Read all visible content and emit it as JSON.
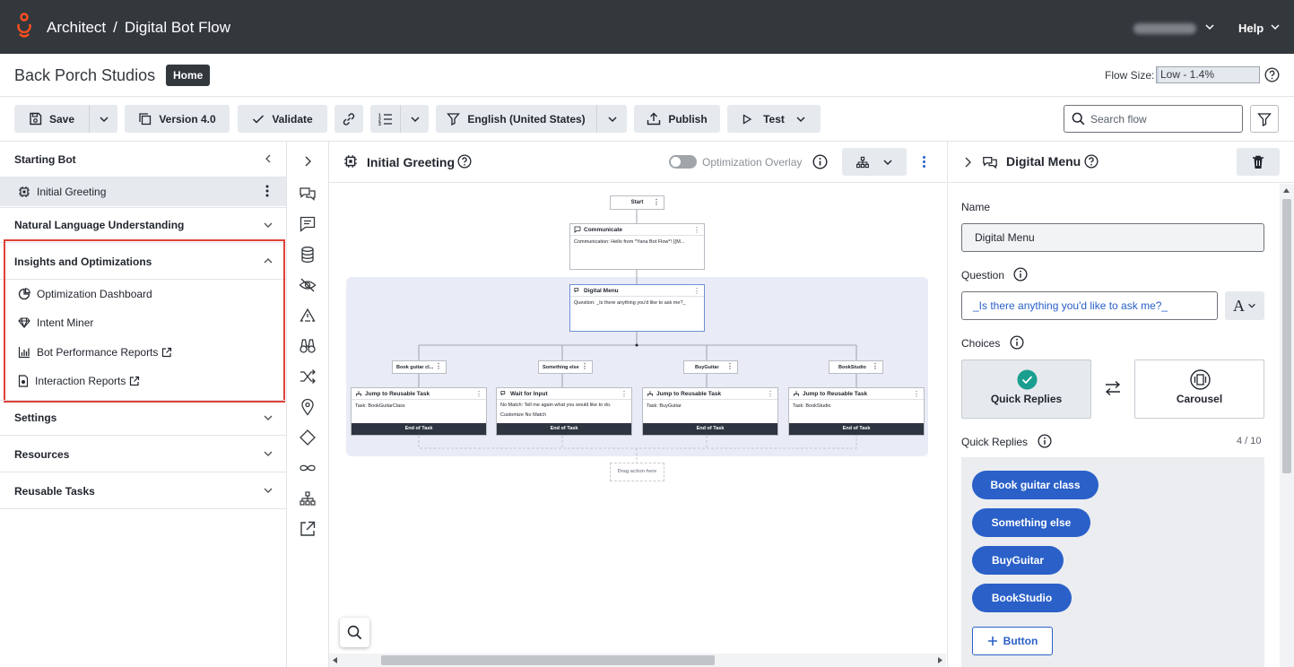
{
  "app": {
    "name": "Architect",
    "flow_name": "Digital Bot Flow",
    "help_label": "Help"
  },
  "org": {
    "name": "Back Porch Studios",
    "home_label": "Home"
  },
  "flow_size": {
    "label": "Flow Size:",
    "value": "Low - 1.4%",
    "percent": 1.4
  },
  "toolbar": {
    "save_label": "Save",
    "version_label": "Version 4.0",
    "validate_label": "Validate",
    "language_label": "English (United States)",
    "publish_label": "Publish",
    "test_label": "Test",
    "search_placeholder": "Search flow"
  },
  "sidebar": {
    "starting_bot": {
      "label": "Starting Bot",
      "items": [
        {
          "label": "Initial Greeting"
        }
      ]
    },
    "nlu": {
      "label": "Natural Language Understanding"
    },
    "insights": {
      "label": "Insights and Optimizations",
      "items": [
        {
          "label": "Optimization Dashboard"
        },
        {
          "label": "Intent Miner"
        },
        {
          "label": "Bot Performance Reports"
        },
        {
          "label": "Interaction Reports"
        }
      ]
    },
    "settings": {
      "label": "Settings"
    },
    "resources": {
      "label": "Resources"
    },
    "reusable_tasks": {
      "label": "Reusable Tasks"
    }
  },
  "canvas": {
    "title": "Initial Greeting",
    "overlay_label": "Optimization Overlay",
    "nodes": {
      "start": "Start",
      "communicate": {
        "title": "Communicate",
        "body": "Communication: Hello from *Yana Bot Flow*! {{M..."
      },
      "digital_menu": {
        "title": "Digital Menu",
        "body": "Question: _Is there anything you'd like to ask me?_"
      },
      "branches": [
        "Book guitar cl...",
        "Something else",
        "BuyGuitar",
        "BookStudio"
      ],
      "tasks": [
        {
          "title": "Jump to Reusable Task",
          "body": "Task: BookGuitarClass",
          "foot": "End of Task"
        },
        {
          "title": "Wait for Input",
          "body": "No Match: Tell me again what you would like to do.",
          "body2": "Customize No Match",
          "foot": "End of Task"
        },
        {
          "title": "Jump to Reusable Task",
          "body": "Task: BuyGuitar",
          "foot": "End of Task"
        },
        {
          "title": "Jump to Reusable Task",
          "body": "Task: BookStudio",
          "foot": "End of Task"
        }
      ],
      "drag_placeholder": "Drag action here"
    }
  },
  "panel": {
    "title": "Digital Menu",
    "name_label": "Name",
    "name_value": "Digital Menu",
    "question_label": "Question",
    "question_value": "_Is there anything you'd like to ask me?_",
    "choices_label": "Choices",
    "choice_quick": "Quick Replies",
    "choice_carousel": "Carousel",
    "quick_replies_label": "Quick Replies",
    "quick_replies_count": "4 / 10",
    "quick_replies": [
      "Book guitar class",
      "Something else",
      "BuyGuitar",
      "BookStudio"
    ],
    "add_button_label": "Button"
  }
}
